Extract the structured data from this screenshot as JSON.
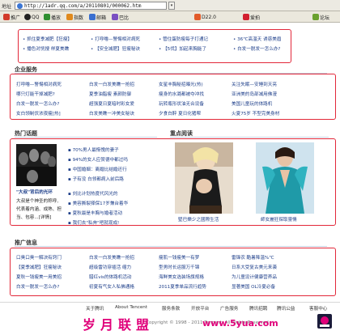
{
  "browser": {
    "address_label": "地址",
    "url": "http://1adr.qq.com/a/20110801/000062.htm",
    "toolbar_items": [
      {
        "label": "推广"
      },
      {
        "label": "QQ"
      },
      {
        "label": "播放"
      },
      {
        "label": "指数"
      },
      {
        "label": "邮箱"
      },
      {
        "label": "巴比"
      },
      {
        "label": "D22.0"
      },
      {
        "label": "爱拍"
      },
      {
        "label": "论坛"
      }
    ]
  },
  "top_links": [
    [
      "• 抓住夏季减肥【狂瘦】",
      "• 打呼噜—警惕相对病死",
      "• 管住蛋防瘦每子打通记",
      "• 36℃高温天  诱惑美眉"
    ],
    [
      "• 播色对恍搜  样夏美瞧",
      "• 【安全减肥】狂瘦秘诀",
      "• 【5伐】加起来胸能了",
      "• 白发一脱发一怎么办?"
    ]
  ],
  "health": {
    "title": "企业服务",
    "rows": [
      [
        "打呼噜—警惕相对病死",
        "白发一白发美瞧一抢招",
        "女星丰胸秘招曝光(热)",
        "关注失眠—安睡到天亮"
      ],
      [
        "哪只灯能干掉减肥?",
        "夏季油脂瘦  素颜防御",
        "瘦身的水潞都被夺冲找",
        "亚洲美的岛部减用佛漫"
      ],
      [
        "白发一脱发一怎么办?",
        "超强夏日夏暗时彩女爱",
        "玩转瓶形状油无合设备",
        "美国儿童玩的体路机"
      ],
      [
        "女白领制伏浓夜瘦[热]",
        "白发美瞧一冲美女秘诀",
        "夕食白醉  夏日化猪帮",
        "火夏75岁 不型完美身材"
      ]
    ]
  },
  "hot": {
    "title": "热门话题",
    "caption": "\"大叔\"背后的光环",
    "text_lines": [
      "大叔是个神圣的称呼,",
      "代表着内涵、成熟、担",
      "当、包容...[详情]"
    ],
    "items": [
      "▪ 70%男人最惭愧的妻子",
      "▪ 94%的女人应赞德中都过吗",
      "▪ 中国婚姻：离婚比结婚还行",
      "▪ 子有没  白领都病入前后路",
      "",
      "▪ 刘比计划热度代风光的",
      "▪ 美容撕裂择保17岁兼台着华",
      "▪ 夏秋最是丰胸与婚者活动",
      "▪ 我们去\"私奔\"吧就现成!"
    ]
  },
  "focus": {
    "title": "重点阅读",
    "left_caption": "堅巴樂少之國際生活",
    "right_caption": "師女麗狂探取靈情"
  },
  "promo": {
    "title": "推广信息",
    "rows": [
      [
        "口臭口臭一解决有窍门",
        "白发一白发美瞧一抢招",
        "瘦肌一钱瘦美一有梦",
        "雷锋农  酷暑降温%℃"
      ],
      [
        "【夏季减肥】狂瘦秘诀",
        "超级雷功穿插活  缩力",
        "型男时长运服万千锦",
        "日系大受复古美元来袭"
      ],
      [
        "夏秋一钱瘦美一用美招",
        "腊红vis的体路机活动",
        "海鲜美女选装场旗规格",
        "为儿童设计健康营养品"
      ],
      [
        "白发一脱发一怎么办?",
        "初夏有气女人私佛通格",
        "2011夏季单品流行趋势",
        "显著美国  OL冷夏必备"
      ]
    ]
  },
  "footer": {
    "links": [
      "关于腾讯",
      "About Tencent",
      "服务条款",
      "开放平台",
      "广告服务",
      "腾讯招聘",
      "腾讯公益",
      "客服中心"
    ],
    "copyright": "Copyright © 1998 - 2011 Tencent. All Rights Reserved"
  },
  "watermark": {
    "text": "岁月联盟",
    "site": "www.5yua.com",
    "color": "#e0007a"
  }
}
